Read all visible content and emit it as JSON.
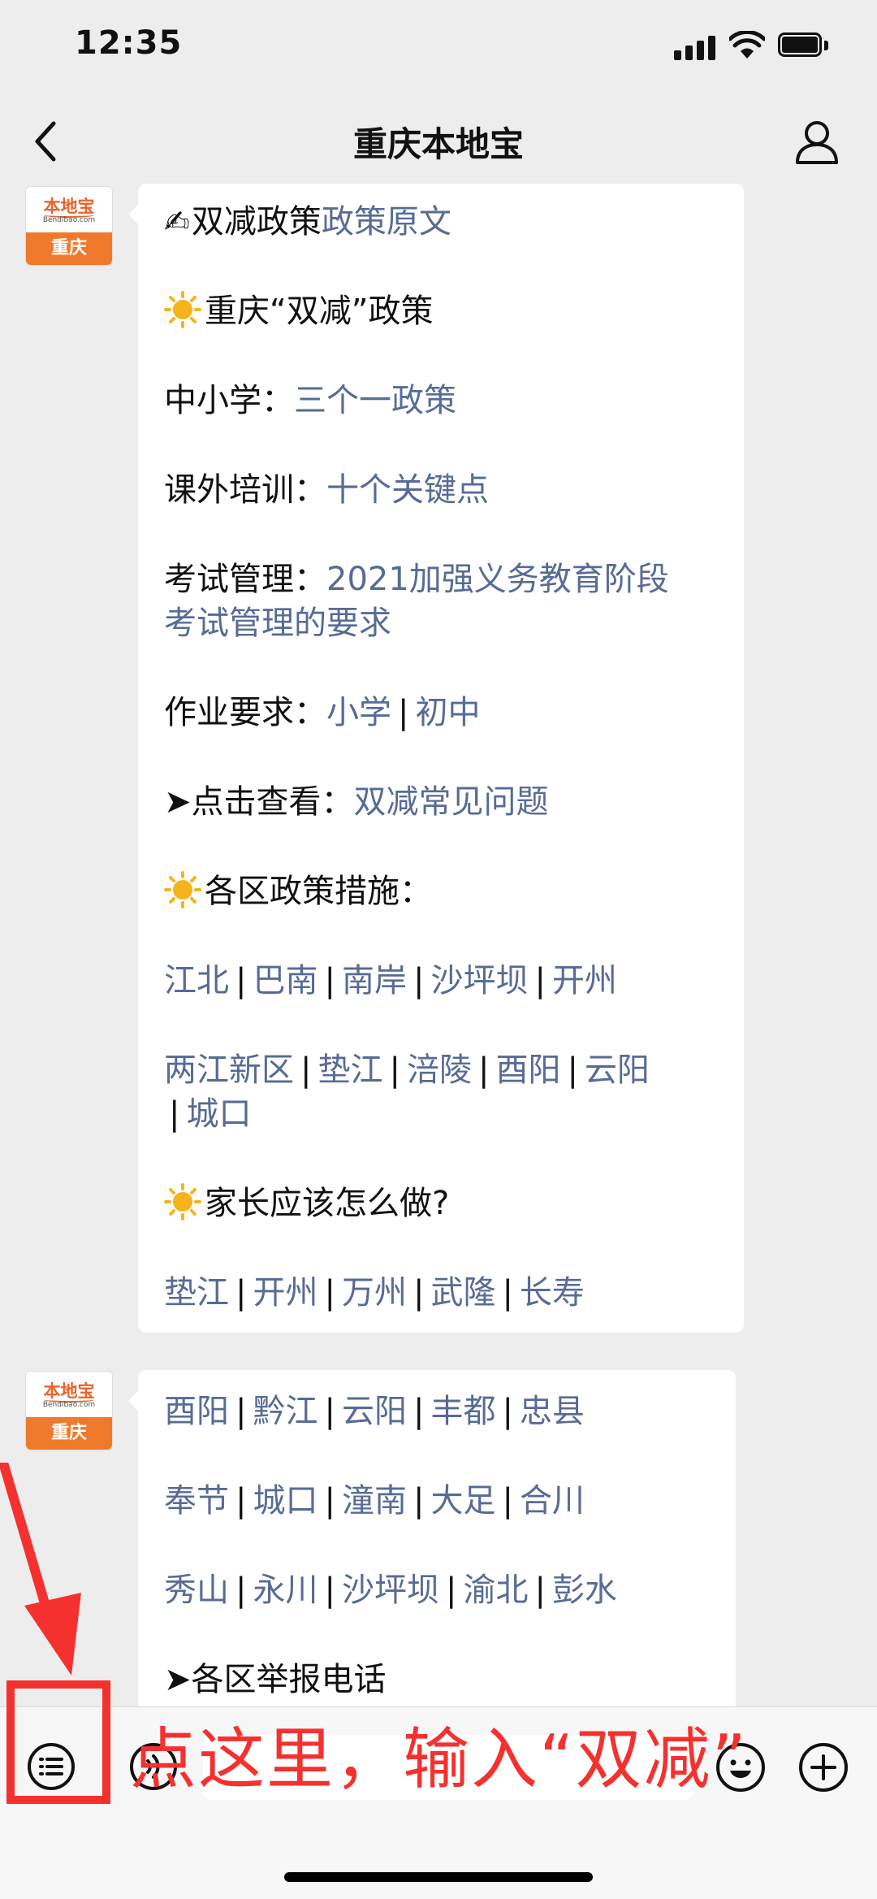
{
  "status": {
    "time": "12:35"
  },
  "nav": {
    "title": "重庆本地宝"
  },
  "avatar": {
    "brand": "本地宝",
    "site": "Bendibao.com",
    "city": "重庆"
  },
  "message1": {
    "l1_label": "双减政策",
    "l1_link": "政策原文",
    "l2_label": "重庆“双减”政策",
    "l3_label": "中小学：",
    "l3_link": "三个一政策",
    "l4_label": "课外培训：",
    "l4_link": "十个关键点",
    "l5_label": "考试管理：",
    "l5_link_a": "2021加强义务教育阶段",
    "l5_link_b": "考试管理的要求",
    "l6_label": "作业要求：",
    "l6_links": [
      "小学",
      "初中"
    ],
    "l7_label": "➤点击查看：",
    "l7_link": "双减常见问题",
    "l8_label": "各区政策措施：",
    "districts_row1": [
      "江北",
      "巴南",
      "南岸",
      "沙坪坝",
      "开州"
    ],
    "districts_row2": [
      "两江新区",
      "垫江",
      "涪陵",
      "酉阳",
      "云阳"
    ],
    "districts_row3": [
      "城口"
    ],
    "l9_label": "家长应该怎么做?",
    "districts_row4": [
      "垫江",
      "开州",
      "万州",
      "武隆",
      "长寿"
    ]
  },
  "message2": {
    "row1": [
      "酉阳",
      "黔江",
      "云阳",
      "丰都",
      "忠县"
    ],
    "row2": [
      "奉节",
      "城口",
      "潼南",
      "大足",
      "合川"
    ],
    "row3": [
      "秀山",
      "永川",
      "沙坪坝",
      "渝北",
      "彭水"
    ],
    "report_label": "➤各区举报电话"
  },
  "annotation": {
    "text": "点这里，输入“双减”"
  },
  "colors": {
    "link": "#576b95",
    "annotation": "#f5312f",
    "avatar_orange": "#f07a2b"
  }
}
